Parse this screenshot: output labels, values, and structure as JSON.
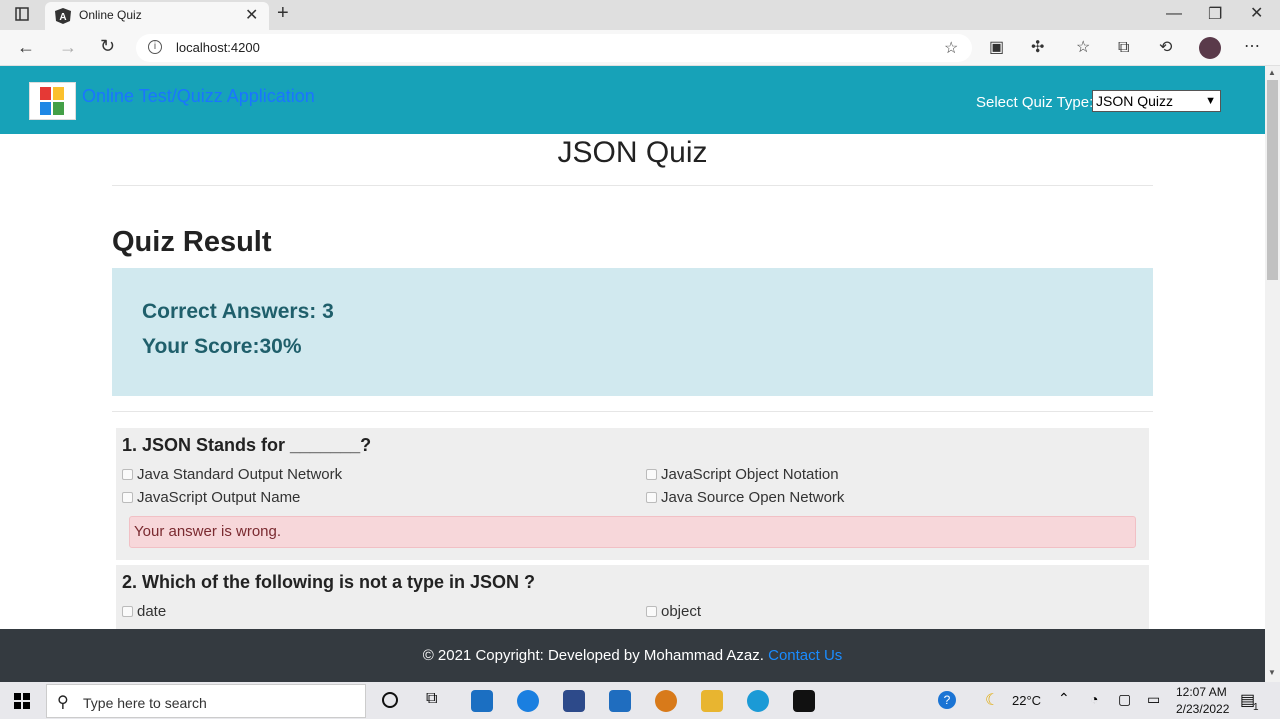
{
  "browser": {
    "tab_title": "Online Quiz",
    "address": "localhost:4200"
  },
  "navbar": {
    "brand": "Online Test/Quizz Application",
    "select_label": "Select Quiz Type:",
    "select_value": "JSON Quizz"
  },
  "page": {
    "title": "JSON Quiz",
    "result_heading": "Quiz Result",
    "correct_answers": "Correct Answers: 3",
    "score": "Your Score:30%"
  },
  "questions": [
    {
      "text": "1. JSON Stands for _______?",
      "options": [
        "Java Standard Output Network",
        "JavaScript Object Notation",
        "JavaScript Output Name",
        "Java Source Open Network"
      ],
      "feedback": "Your answer is wrong."
    },
    {
      "text": "2. Which of the following is not a type in JSON ?",
      "options": [
        "date",
        "object"
      ]
    }
  ],
  "footer": {
    "text": "© 2021 Copyright: Developed by Mohammad Azaz.",
    "link": "Contact Us"
  },
  "taskbar": {
    "search_placeholder": "Type here to search",
    "temperature": "22°C",
    "time": "12:07 AM",
    "date": "2/23/2022",
    "notification_count": "1"
  },
  "colors": {
    "navbar": "#17a2b8",
    "brand_link": "#1a75ff",
    "result_box": "#d1e9ef",
    "alert_danger": "#f7d7da",
    "footer": "#343a40"
  }
}
